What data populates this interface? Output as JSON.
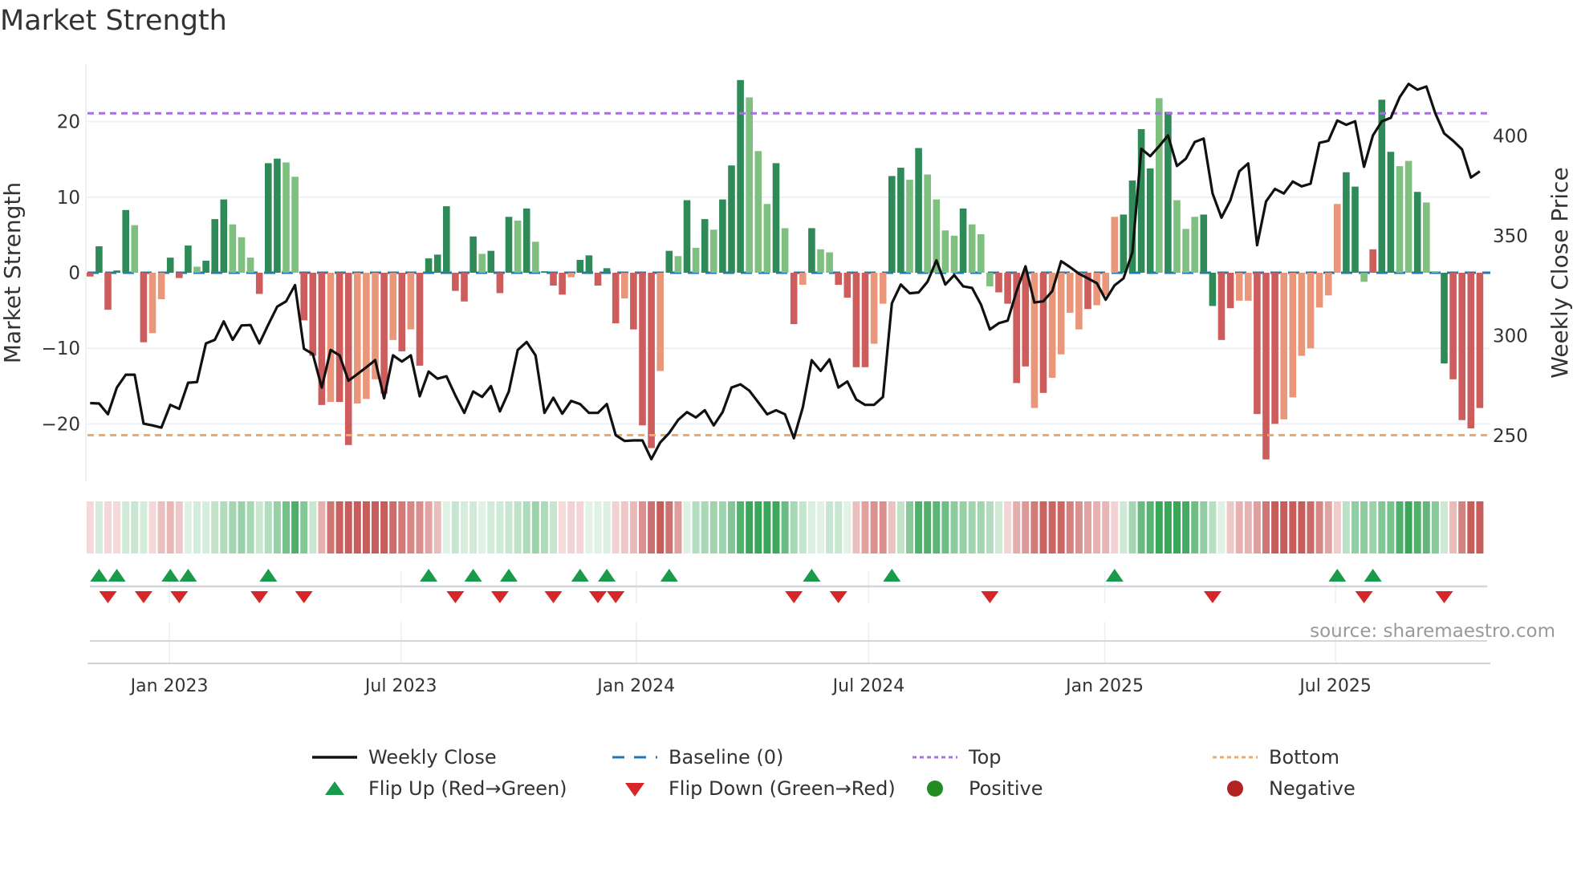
{
  "title": "Market Strength",
  "source": "source: sharemaestro.com",
  "legend": {
    "weekly_close": "Weekly Close",
    "baseline": "Baseline (0)",
    "top": "Top",
    "bottom": "Bottom",
    "flip_up": "Flip Up (Red→Green)",
    "flip_down": "Flip Down (Green→Red)",
    "positive": "Positive",
    "negative": "Negative"
  },
  "colors": {
    "strong_up": "#2e8b57",
    "weak_up": "#7fbf7f",
    "strong_down": "#cd5c5c",
    "weak_down": "#e9967a",
    "baseline": "#1f77b4",
    "top": "#a970e0",
    "bottom": "#f0a868",
    "close": "#111111",
    "flip_up": "#1a9b4b",
    "flip_down": "#d62728",
    "positive": "#228b22",
    "negative": "#b22222"
  },
  "chart_data": {
    "type": "bar+line",
    "title": "Market Strength",
    "ylabel": "Market Strength",
    "y2label": "Weekly Close Price",
    "ylim": [
      -27.6,
      27.6
    ],
    "y2lim": [
      227,
      436
    ],
    "yticks": [
      20,
      10,
      0,
      -10,
      -20
    ],
    "y2ticks": [
      400,
      350,
      300,
      250
    ],
    "top_threshold": 21.1,
    "bottom_threshold": -21.5,
    "xticks": [
      {
        "label": "Jan 2023",
        "week": 8.9
      },
      {
        "label": "Jul 2023",
        "week": 34.9
      },
      {
        "label": "Jan 2024",
        "week": 61.3
      },
      {
        "label": "Jul 2024",
        "week": 87.4
      },
      {
        "label": "Jan 2025",
        "week": 113.9
      },
      {
        "label": "Jul 2025",
        "week": 139.8
      }
    ],
    "strength": [
      -0.5,
      3.5,
      -4.9,
      0.3,
      8.3,
      6.3,
      -9.2,
      -8,
      -3.5,
      2,
      -0.7,
      3.6,
      0.8,
      1.6,
      7.1,
      9.7,
      6.4,
      4.7,
      2,
      -2.8,
      14.5,
      15.1,
      14.6,
      12.7,
      -6.3,
      -11,
      -17.5,
      -17.1,
      -17.1,
      -22.8,
      -17.3,
      -16.7,
      -14.1,
      -16,
      -8.9,
      -10.4,
      -7.5,
      -12.3,
      1.9,
      2.4,
      8.8,
      -2.4,
      -3.8,
      4.8,
      2.5,
      2.9,
      -2.7,
      7.4,
      6.9,
      8.5,
      4.1,
      0.2,
      -1.7,
      -2.9,
      -0.6,
      1.7,
      2.3,
      -1.7,
      0.6,
      -6.7,
      -3.4,
      -7.5,
      -20.2,
      -23.2,
      -13,
      2.9,
      2.2,
      9.6,
      3.3,
      7.1,
      5.7,
      9.7,
      14.2,
      25.5,
      23.2,
      16.1,
      9.1,
      14.5,
      5.9,
      -6.8,
      -1.6,
      5.9,
      3.1,
      2.7,
      -1.6,
      -3.3,
      -12.5,
      -12.5,
      -9.4,
      -4.1,
      12.8,
      13.9,
      12.3,
      16.5,
      13,
      9.7,
      5.6,
      4.9,
      8.5,
      6.4,
      5.1,
      -1.8,
      -2.6,
      -4.1,
      -14.6,
      -12.4,
      -17.9,
      -15.9,
      -13.9,
      -10.8,
      -5.3,
      -7.5,
      -4.8,
      -4.3,
      -3,
      7.4,
      7.7,
      12.2,
      19,
      13.8,
      23.1,
      21.3,
      9.6,
      5.8,
      7.4,
      7.7,
      -4.4,
      -8.9,
      -4.7,
      -3.7,
      -3.7,
      -18.7,
      -24.7,
      -20,
      -19.4,
      -16.5,
      -11,
      -10,
      -4.6,
      -3,
      9.1,
      13.3,
      11.4,
      -1.2,
      3.1,
      22.9,
      16,
      14.1,
      14.8,
      10.7,
      9.3,
      0.2,
      -12,
      -14.1,
      -19.5,
      -20.6,
      -17.9
    ],
    "shade": "RGRGGgRrrGRGgGGGgggRGGggRRRrRRrrrRrRrRGGGRRGgGRGgGgGRRrGGRGRrRRRrGgGgGgGGGgggGgRrGggRRRRrrGGgGggggGgggRRRRrRrrrrRrrrGGGGgGgggGGRRrrRRRrrrrrrrGGgRGGggGggGRRRRr",
    "close": [
      266.2,
      266,
      260.6,
      274,
      280.4,
      280.4,
      255.9,
      255,
      253.9,
      265.3,
      263.3,
      276.4,
      276.7,
      296.1,
      297.9,
      307.1,
      297.9,
      305.1,
      305.3,
      296.1,
      305.5,
      314.5,
      317.2,
      325.3,
      293.4,
      290.8,
      274,
      292.8,
      290.1,
      277.4,
      280.7,
      284.1,
      287.7,
      268.6,
      290.1,
      287,
      290.1,
      269.6,
      282,
      278.4,
      279.6,
      270,
      261.3,
      272,
      269.3,
      274.7,
      262,
      272,
      292.8,
      296.8,
      290.1,
      261.3,
      268.9,
      260.9,
      267.3,
      265.7,
      261.3,
      261.3,
      265.7,
      250.1,
      247.2,
      247.5,
      247.5,
      238.1,
      246.5,
      251.2,
      257.7,
      261.7,
      259,
      262.6,
      255,
      261.7,
      274,
      275.6,
      272.4,
      266.6,
      260.6,
      262.6,
      260.6,
      248.6,
      264,
      287.7,
      282.3,
      288.1,
      274,
      277,
      268,
      265.3,
      265.3,
      269.3,
      316.2,
      325.6,
      321.2,
      321.6,
      327,
      337.7,
      325.6,
      330.3,
      324.7,
      323.9,
      315.6,
      303.1,
      306.2,
      307.5,
      322.3,
      334.7,
      316.6,
      317.2,
      322.3,
      337.3,
      334.3,
      331,
      328.7,
      326.3,
      318,
      325.2,
      328.7,
      341.7,
      393.6,
      389.9,
      394.9,
      400.3,
      385,
      388.6,
      397,
      398.7,
      371.2,
      359.1,
      367.8,
      382.3,
      386.3,
      345.3,
      367.2,
      373.5,
      371.2,
      377.2,
      374.8,
      376.1,
      396.6,
      397.6,
      407.8,
      405.6,
      407.4,
      384.6,
      400.3,
      407.4,
      409.1,
      419.4,
      426.1,
      423.2,
      424.8,
      411.4,
      401.3,
      397.6,
      393.3,
      379.2,
      382.3
    ],
    "flips_up": [
      1,
      3,
      9,
      11,
      20,
      38,
      43,
      47,
      55,
      58,
      65,
      81,
      90,
      115,
      140,
      144
    ],
    "flips_down": [
      2,
      6,
      10,
      19,
      24,
      41,
      46,
      52,
      57,
      59,
      79,
      84,
      101,
      126,
      143,
      152
    ]
  }
}
